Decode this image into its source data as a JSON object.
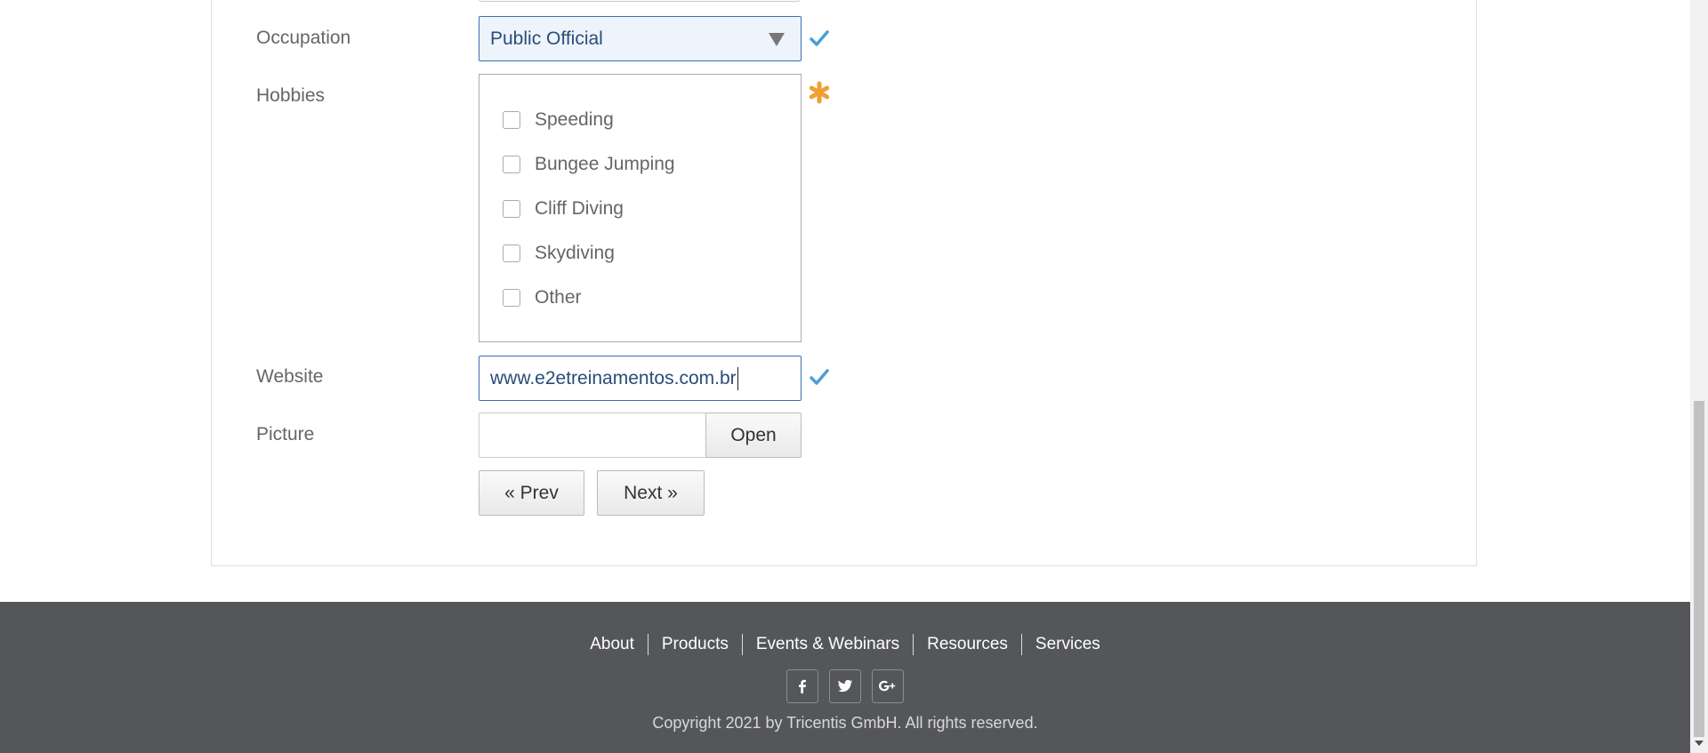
{
  "form": {
    "occupation": {
      "label": "Occupation",
      "selected": "Public Official"
    },
    "hobbies": {
      "label": "Hobbies",
      "options": [
        {
          "label": "Speeding",
          "checked": false
        },
        {
          "label": "Bungee Jumping",
          "checked": false
        },
        {
          "label": "Cliff Diving",
          "checked": false
        },
        {
          "label": "Skydiving",
          "checked": false
        },
        {
          "label": "Other",
          "checked": false
        }
      ]
    },
    "website": {
      "label": "Website",
      "value": "www.e2etreinamentos.com.br"
    },
    "picture": {
      "label": "Picture",
      "value": "",
      "open_label": "Open"
    },
    "buttons": {
      "prev_label": "« Prev",
      "next_label": "Next »"
    }
  },
  "footer": {
    "nav": [
      "About",
      "Products",
      "Events & Webinars",
      "Resources",
      "Services"
    ],
    "social_icons": [
      "facebook-icon",
      "twitter-icon",
      "google-plus-icon"
    ],
    "copyright": "Copyright 2021 by Tricentis GmbH. All rights reserved."
  },
  "colors": {
    "valid_check": "#4a9fd5",
    "required_star": "#f0a030",
    "footer_bg": "#54565a",
    "input_border_active": "#3a6fb0"
  }
}
